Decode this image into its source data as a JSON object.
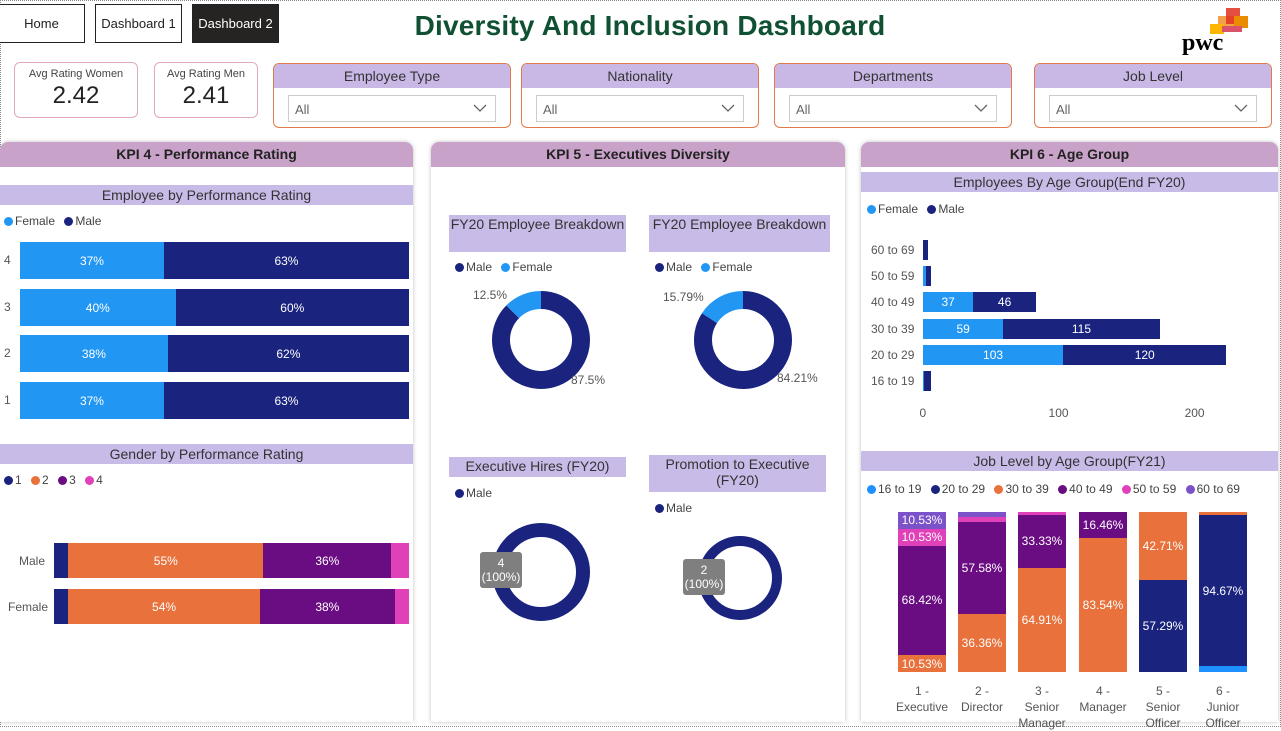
{
  "nav": {
    "home": "Home",
    "dash1": "Dashboard 1",
    "dash2": "Dashboard 2"
  },
  "title": "Diversity And Inclusion Dashboard",
  "logo_text": "pwc",
  "kpis": {
    "women": {
      "label": "Avg Rating Women",
      "value": "2.42"
    },
    "men": {
      "label": "Avg Rating Men",
      "value": "2.41"
    }
  },
  "slicers": [
    {
      "title": "Employee Type",
      "value": "All"
    },
    {
      "title": "Nationality",
      "value": "All"
    },
    {
      "title": "Departments",
      "value": "All"
    },
    {
      "title": "Job Level",
      "value": "All"
    }
  ],
  "colors": {
    "female": "#2196f3",
    "male": "#1a237e",
    "orange": "#e8713c",
    "purple": "#6a0d83",
    "pink": "#e040b8",
    "violet": "#7b52c9",
    "light_blue": "#1e90ff"
  },
  "kpi4": {
    "title": "KPI 4 - Performance Rating",
    "chart1_title": "Employee by Performance Rating",
    "legend": [
      "Female",
      "Male"
    ],
    "chart2_title": "Gender by Performance Rating",
    "legend2": [
      "1",
      "2",
      "3",
      "4"
    ]
  },
  "kpi5": {
    "title": "KPI 5 - Executives Diversity",
    "donut1_title": "FY20 Employee Breakdown",
    "donut2_title": "FY20 Employee Breakdown",
    "donut3_title": "Executive Hires (FY20)",
    "donut4_title": "Promotion to Executive (FY20)",
    "legend_mf": [
      "Male",
      "Female"
    ],
    "legend_m": [
      "Male"
    ],
    "donut1_labels": {
      "female": "12.5%",
      "male": "87.5%"
    },
    "donut2_labels": {
      "female": "15.79%",
      "male": "84.21%"
    },
    "donut3_tip": {
      "count": "4",
      "pct": "(100%)"
    },
    "donut4_tip": {
      "count": "2",
      "pct": "(100%)"
    }
  },
  "kpi6": {
    "title": "KPI 6 - Age Group",
    "chart1_title": "Employees By Age Group(End FY20)",
    "legend": [
      "Female",
      "Male"
    ],
    "chart2_title": "Job Level by Age Group(FY21)",
    "legend2": [
      "16 to 19",
      "20 to 29",
      "30 to 39",
      "40 to 49",
      "50 to 59",
      "60 to 69"
    ]
  },
  "chart_data": [
    {
      "type": "bar",
      "title": "Employee by Performance Rating",
      "orientation": "horizontal-stacked-100",
      "categories": [
        "4",
        "3",
        "2",
        "1"
      ],
      "series": [
        {
          "name": "Female",
          "values": [
            37,
            40,
            38,
            37
          ],
          "labels": [
            "37%",
            "40%",
            "38%",
            "37%"
          ]
        },
        {
          "name": "Male",
          "values": [
            63,
            60,
            62,
            63
          ],
          "labels": [
            "63%",
            "60%",
            "62%",
            "63%"
          ]
        }
      ]
    },
    {
      "type": "bar",
      "title": "Gender by Performance Rating",
      "orientation": "horizontal-stacked-100",
      "categories": [
        "Male",
        "Female"
      ],
      "series": [
        {
          "name": "1",
          "values": [
            4,
            4
          ],
          "labels": [
            "",
            ""
          ]
        },
        {
          "name": "2",
          "values": [
            55,
            54
          ],
          "labels": [
            "55%",
            "54%"
          ]
        },
        {
          "name": "3",
          "values": [
            36,
            38
          ],
          "labels": [
            "36%",
            "38%"
          ]
        },
        {
          "name": "4",
          "values": [
            5,
            4
          ],
          "labels": [
            "",
            ""
          ]
        }
      ]
    },
    {
      "type": "pie",
      "title": "FY20 Employee Breakdown",
      "slices": [
        {
          "name": "Male",
          "value": 87.5
        },
        {
          "name": "Female",
          "value": 12.5
        }
      ]
    },
    {
      "type": "pie",
      "title": "FY20 Employee Breakdown",
      "slices": [
        {
          "name": "Male",
          "value": 84.21
        },
        {
          "name": "Female",
          "value": 15.79
        }
      ]
    },
    {
      "type": "pie",
      "title": "Executive Hires (FY20)",
      "slices": [
        {
          "name": "Male",
          "value": 4
        }
      ]
    },
    {
      "type": "pie",
      "title": "Promotion to Executive (FY20)",
      "slices": [
        {
          "name": "Male",
          "value": 2
        }
      ]
    },
    {
      "type": "bar",
      "title": "Employees By Age Group(End FY20)",
      "orientation": "horizontal-stacked",
      "categories": [
        "60 to 69",
        "50 to 59",
        "40 to 49",
        "30 to 39",
        "20 to 29",
        "16 to 19"
      ],
      "series": [
        {
          "name": "Female",
          "values": [
            0,
            2,
            37,
            59,
            103,
            1
          ],
          "labels": [
            "",
            "",
            "37",
            "59",
            "103",
            ""
          ]
        },
        {
          "name": "Male",
          "values": [
            4,
            4,
            46,
            115,
            120,
            5
          ],
          "labels": [
            "",
            "",
            "46",
            "115",
            "120",
            ""
          ]
        }
      ],
      "xticks": [
        "0",
        "100",
        "200"
      ],
      "xlim": [
        0,
        200
      ]
    },
    {
      "type": "bar",
      "title": "Job Level by Age Group(FY21)",
      "orientation": "vertical-stacked-100",
      "categories": [
        "1 - Executive",
        "2 - Director",
        "3 - Senior Manager",
        "4 - Manager",
        "5 - Senior Officer",
        "6 - Junior Officer"
      ],
      "series": [
        {
          "name": "16 to 19",
          "values": [
            0,
            0,
            0,
            0,
            0,
            3.5
          ],
          "labels": [
            "",
            "",
            "",
            "",
            "",
            ""
          ]
        },
        {
          "name": "20 to 29",
          "values": [
            0,
            0,
            0,
            0,
            57.29,
            94.67
          ],
          "labels": [
            "",
            "",
            "",
            "",
            "57.29%",
            "94.67%"
          ]
        },
        {
          "name": "30 to 39",
          "values": [
            10.53,
            36.36,
            64.91,
            83.54,
            42.71,
            1.83
          ],
          "labels": [
            "10.53%",
            "36.36%",
            "64.91%",
            "83.54%",
            "42.71%",
            ""
          ]
        },
        {
          "name": "40 to 49",
          "values": [
            68.42,
            57.58,
            33.33,
            16.46,
            0,
            0
          ],
          "labels": [
            "68.42%",
            "57.58%",
            "33.33%",
            "16.46%",
            "",
            ""
          ]
        },
        {
          "name": "50 to 59",
          "values": [
            10.53,
            3.03,
            1.76,
            0,
            0,
            0
          ],
          "labels": [
            "10.53%",
            "",
            "",
            "",
            "",
            ""
          ]
        },
        {
          "name": "60 to 69",
          "values": [
            10.53,
            3.03,
            0,
            0,
            0,
            0
          ],
          "labels": [
            "10.53%",
            "",
            "",
            "",
            "",
            ""
          ]
        }
      ]
    }
  ]
}
